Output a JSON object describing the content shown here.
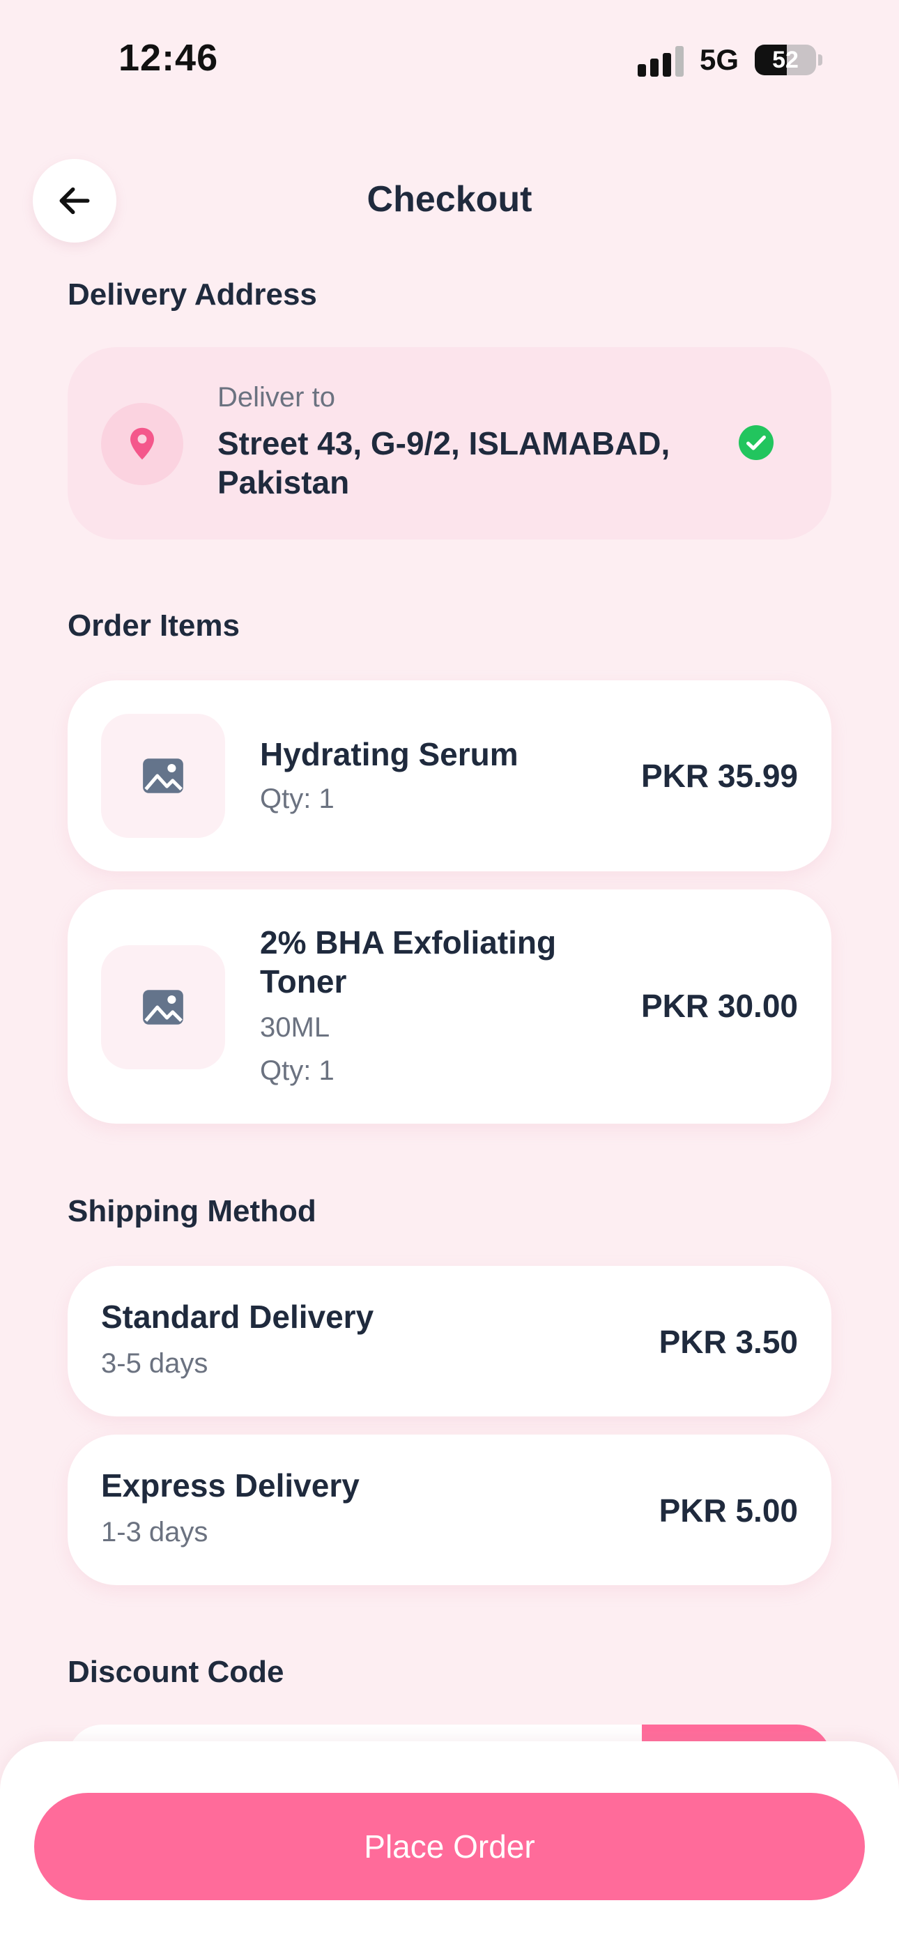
{
  "status_bar": {
    "time": "12:46",
    "network": "5G",
    "battery": "52",
    "battery_level": 0.52
  },
  "header": {
    "title": "Checkout"
  },
  "delivery": {
    "section_title": "Delivery Address",
    "label": "Deliver to",
    "address": "Street 43, G-9/2, ISLAMABAD, Pakistan",
    "pin_color": "#f4578b",
    "check_color": "#22c55e"
  },
  "order_items": {
    "section_title": "Order Items",
    "items": [
      {
        "name": "Hydrating Serum",
        "variant": "",
        "qty": "Qty: 1",
        "price": "PKR 35.99"
      },
      {
        "name": "2% BHA Exfoliating Toner",
        "variant": "30ML",
        "qty": "Qty: 1",
        "price": "PKR 30.00"
      }
    ]
  },
  "shipping": {
    "section_title": "Shipping Method",
    "options": [
      {
        "name": "Standard Delivery",
        "days": "3-5 days",
        "price": "PKR 3.50"
      },
      {
        "name": "Express Delivery",
        "days": "1-3 days",
        "price": "PKR 5.00"
      }
    ]
  },
  "discount": {
    "section_title": "Discount Code"
  },
  "footer": {
    "place_order_label": "Place Order"
  },
  "colors": {
    "accent": "#ff6b9a",
    "background": "#fdeef2",
    "text": "#1f2a3d"
  }
}
